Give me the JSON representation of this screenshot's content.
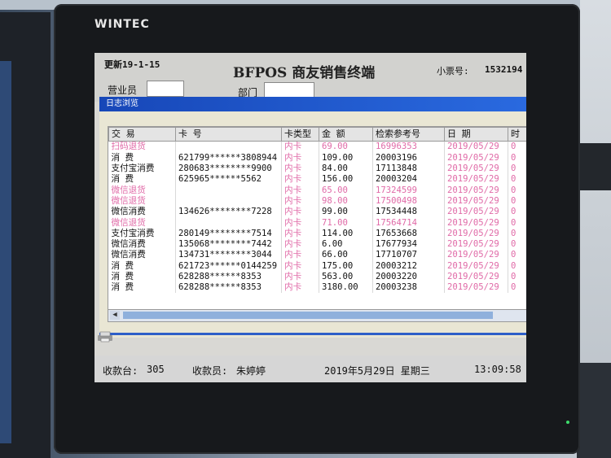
{
  "brand": "WINTEC",
  "pos": {
    "version": "更新19-1-15",
    "title": "BFPOS 商友销售终端",
    "receipt_label": "小票号:",
    "receipt_no": "1532194",
    "clerk_label": "营业员",
    "dept_label": "部门"
  },
  "dialog": {
    "title": "日志浏览",
    "columns": [
      "交 易",
      "卡 号",
      "卡类型",
      "金 额",
      "检索参考号",
      "日 期",
      "时"
    ],
    "rows": [
      {
        "type": "扫码退货",
        "card": "",
        "ctype": "内卡",
        "amount": "69.00",
        "ref": "16996353",
        "date": "2019/05/29",
        "time": "0",
        "refund": true
      },
      {
        "type": "消    费",
        "card": "621799******3808944",
        "ctype": "内卡",
        "amount": "109.00",
        "ref": "20003196",
        "date": "2019/05/29",
        "time": "0",
        "refund": false
      },
      {
        "type": "支付宝消费",
        "card": "280683********9900",
        "ctype": "内卡",
        "amount": "84.00",
        "ref": "17113848",
        "date": "2019/05/29",
        "time": "0",
        "refund": false
      },
      {
        "type": "消    费",
        "card": "625965******5562",
        "ctype": "内卡",
        "amount": "156.00",
        "ref": "20003204",
        "date": "2019/05/29",
        "time": "0",
        "refund": false
      },
      {
        "type": "微信退货",
        "card": "",
        "ctype": "内卡",
        "amount": "65.00",
        "ref": "17324599",
        "date": "2019/05/29",
        "time": "0",
        "refund": true
      },
      {
        "type": "微信退货",
        "card": "",
        "ctype": "内卡",
        "amount": "98.00",
        "ref": "17500498",
        "date": "2019/05/29",
        "time": "0",
        "refund": true
      },
      {
        "type": "微信消费",
        "card": "134626********7228",
        "ctype": "内卡",
        "amount": "99.00",
        "ref": "17534448",
        "date": "2019/05/29",
        "time": "0",
        "refund": false
      },
      {
        "type": "微信退货",
        "card": "",
        "ctype": "内卡",
        "amount": "71.00",
        "ref": "17564714",
        "date": "2019/05/29",
        "time": "0",
        "refund": true
      },
      {
        "type": "支付宝消费",
        "card": "280149********7514",
        "ctype": "内卡",
        "amount": "114.00",
        "ref": "17653668",
        "date": "2019/05/29",
        "time": "0",
        "refund": false
      },
      {
        "type": "微信消费",
        "card": "135068********7442",
        "ctype": "内卡",
        "amount": "6.00",
        "ref": "17677934",
        "date": "2019/05/29",
        "time": "0",
        "refund": false
      },
      {
        "type": "微信消费",
        "card": "134731********3044",
        "ctype": "内卡",
        "amount": "66.00",
        "ref": "17710707",
        "date": "2019/05/29",
        "time": "0",
        "refund": false
      },
      {
        "type": "消    费",
        "card": "621723******0144259",
        "ctype": "内卡",
        "amount": "175.00",
        "ref": "20003212",
        "date": "2019/05/29",
        "time": "0",
        "refund": false
      },
      {
        "type": "消    费",
        "card": "628288******8353",
        "ctype": "内卡",
        "amount": "563.00",
        "ref": "20003220",
        "date": "2019/05/29",
        "time": "0",
        "refund": false
      },
      {
        "type": "消    费",
        "card": "628288******8353",
        "ctype": "内卡",
        "amount": "3180.00",
        "ref": "20003238",
        "date": "2019/05/29",
        "time": "0",
        "refund": false
      }
    ]
  },
  "status": {
    "register_label": "收款台:",
    "register_no": "305",
    "cashier_label": "收款员:",
    "cashier_name": "朱婷婷",
    "date_text": "2019年5月29日  星期三",
    "time_text": "13:09:58"
  },
  "colors": {
    "refund_text": "#e06aa7",
    "title_bar": "#1747b8"
  }
}
